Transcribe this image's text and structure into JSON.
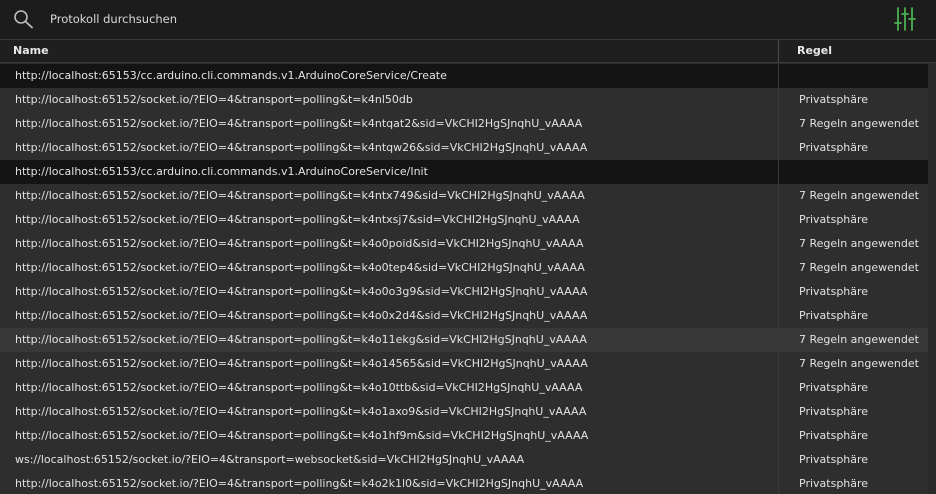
{
  "search": {
    "placeholder": "Protokoll durchsuchen"
  },
  "table": {
    "columns": {
      "name": "Name",
      "rule": "Regel"
    },
    "rows": [
      {
        "url": "http://localhost:65153/cc.arduino.cli.commands.v1.ArduinoCoreService/Create",
        "rule": "",
        "style": "dark"
      },
      {
        "url": "http://localhost:65152/socket.io/?EIO=4&transport=polling&t=k4nl50db",
        "rule": "Privatsphäre",
        "style": "normal"
      },
      {
        "url": "http://localhost:65152/socket.io/?EIO=4&transport=polling&t=k4ntqat2&sid=VkCHI2HgSJnqhU_vAAAA",
        "rule": "7 Regeln angewendet",
        "style": "normal"
      },
      {
        "url": "http://localhost:65152/socket.io/?EIO=4&transport=polling&t=k4ntqw26&sid=VkCHI2HgSJnqhU_vAAAA",
        "rule": "Privatsphäre",
        "style": "normal"
      },
      {
        "url": "http://localhost:65153/cc.arduino.cli.commands.v1.ArduinoCoreService/Init",
        "rule": "",
        "style": "dark"
      },
      {
        "url": "http://localhost:65152/socket.io/?EIO=4&transport=polling&t=k4ntx749&sid=VkCHI2HgSJnqhU_vAAAA",
        "rule": "7 Regeln angewendet",
        "style": "normal"
      },
      {
        "url": "http://localhost:65152/socket.io/?EIO=4&transport=polling&t=k4ntxsj7&sid=VkCHI2HgSJnqhU_vAAAA",
        "rule": "Privatsphäre",
        "style": "normal"
      },
      {
        "url": "http://localhost:65152/socket.io/?EIO=4&transport=polling&t=k4o0poid&sid=VkCHI2HgSJnqhU_vAAAA",
        "rule": "7 Regeln angewendet",
        "style": "normal"
      },
      {
        "url": "http://localhost:65152/socket.io/?EIO=4&transport=polling&t=k4o0tep4&sid=VkCHI2HgSJnqhU_vAAAA",
        "rule": "7 Regeln angewendet",
        "style": "normal"
      },
      {
        "url": "http://localhost:65152/socket.io/?EIO=4&transport=polling&t=k4o0o3g9&sid=VkCHI2HgSJnqhU_vAAAA",
        "rule": "Privatsphäre",
        "style": "normal"
      },
      {
        "url": "http://localhost:65152/socket.io/?EIO=4&transport=polling&t=k4o0x2d4&sid=VkCHI2HgSJnqhU_vAAAA",
        "rule": "Privatsphäre",
        "style": "normal"
      },
      {
        "url": "http://localhost:65152/socket.io/?EIO=4&transport=polling&t=k4o11ekg&sid=VkCHI2HgSJnqhU_vAAAA",
        "rule": "7 Regeln angewendet",
        "style": "hover"
      },
      {
        "url": "http://localhost:65152/socket.io/?EIO=4&transport=polling&t=k4o14565&sid=VkCHI2HgSJnqhU_vAAAA",
        "rule": "7 Regeln angewendet",
        "style": "normal"
      },
      {
        "url": "http://localhost:65152/socket.io/?EIO=4&transport=polling&t=k4o10ttb&sid=VkCHI2HgSJnqhU_vAAAA",
        "rule": "Privatsphäre",
        "style": "normal"
      },
      {
        "url": "http://localhost:65152/socket.io/?EIO=4&transport=polling&t=k4o1axo9&sid=VkCHI2HgSJnqhU_vAAAA",
        "rule": "Privatsphäre",
        "style": "normal"
      },
      {
        "url": "http://localhost:65152/socket.io/?EIO=4&transport=polling&t=k4o1hf9m&sid=VkCHI2HgSJnqhU_vAAAA",
        "rule": "Privatsphäre",
        "style": "normal"
      },
      {
        "url": "ws://localhost:65152/socket.io/?EIO=4&transport=websocket&sid=VkCHI2HgSJnqhU_vAAAA",
        "rule": "Privatsphäre",
        "style": "normal"
      },
      {
        "url": "http://localhost:65152/socket.io/?EIO=4&transport=polling&t=k4o2k1l0&sid=VkCHI2HgSJnqhU_vAAAA",
        "rule": "Privatsphäre",
        "style": "normal"
      }
    ]
  },
  "icons": {
    "search": "search-icon",
    "filter": "sliders-icon"
  },
  "colors": {
    "accent_filter_icon": "#4caf50",
    "search_icon": "#bdbdbd"
  }
}
